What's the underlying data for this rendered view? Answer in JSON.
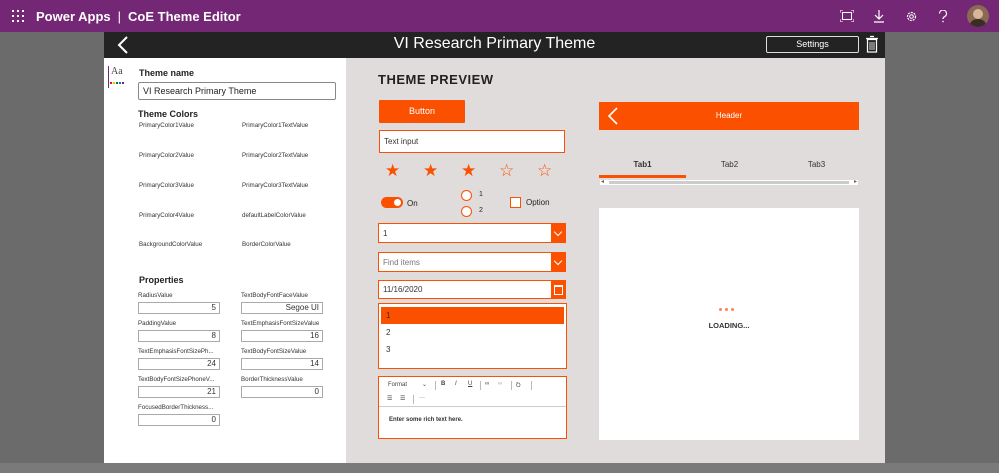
{
  "topbar": {
    "product": "Power Apps",
    "separator": "|",
    "app_name": "CoE Theme Editor"
  },
  "colors": {
    "brand_purple": "#742774",
    "accent_orange": "#fa5000",
    "header_dark": "#232323"
  },
  "app_header": {
    "title": "VI Research Primary Theme",
    "settings_label": "Settings"
  },
  "left_panel": {
    "theme_name_label": "Theme name",
    "theme_name_value": "VI Research Primary Theme",
    "theme_colors_label": "Theme Colors",
    "color_fields": [
      "PrimaryColor1Value",
      "PrimaryColor1TextValue",
      "PrimaryColor2Value",
      "PrimaryColor2TextValue",
      "PrimaryColor3Value",
      "PrimaryColor3TextValue",
      "PrimaryColor4Value",
      "defaultLabelColorValue",
      "BackgroundColorValue",
      "BorderColorValue"
    ],
    "properties_label": "Properties",
    "properties": [
      {
        "label": "RadiusValue",
        "value": "5"
      },
      {
        "label": "TextBodyFontFaceValue",
        "value": "Segoe UI"
      },
      {
        "label": "PaddingValue",
        "value": "8"
      },
      {
        "label": "TextEmphasisFontSizeValue",
        "value": "16"
      },
      {
        "label": "TextEmphasisFontSizePh...",
        "value": "24"
      },
      {
        "label": "TextBodyFontSizeValue",
        "value": "14"
      },
      {
        "label": "TextBodyFontSizePhoneV...",
        "value": "21"
      },
      {
        "label": "BorderThicknessValue",
        "value": "0"
      },
      {
        "label": "FocusedBorderThickness...",
        "value": "0"
      }
    ]
  },
  "preview": {
    "title": "THEME PREVIEW",
    "button_label": "Button",
    "text_input_value": "Text input",
    "toggle_label": "On",
    "radio_options": [
      "1",
      "2"
    ],
    "checkbox_label": "Option",
    "dropdown_value": "1",
    "combobox_placeholder": "Find items",
    "date_value": "11/16/2020",
    "list_items": [
      "1",
      "2",
      "3"
    ],
    "rte": {
      "format_label": "Format",
      "bold": "B",
      "italic": "I",
      "underline": "U",
      "more": "···",
      "placeholder": "Enter some rich text here."
    },
    "header_label": "Header",
    "tabs": [
      "Tab1",
      "Tab2",
      "Tab3"
    ],
    "loading_label": "LOADING..."
  }
}
